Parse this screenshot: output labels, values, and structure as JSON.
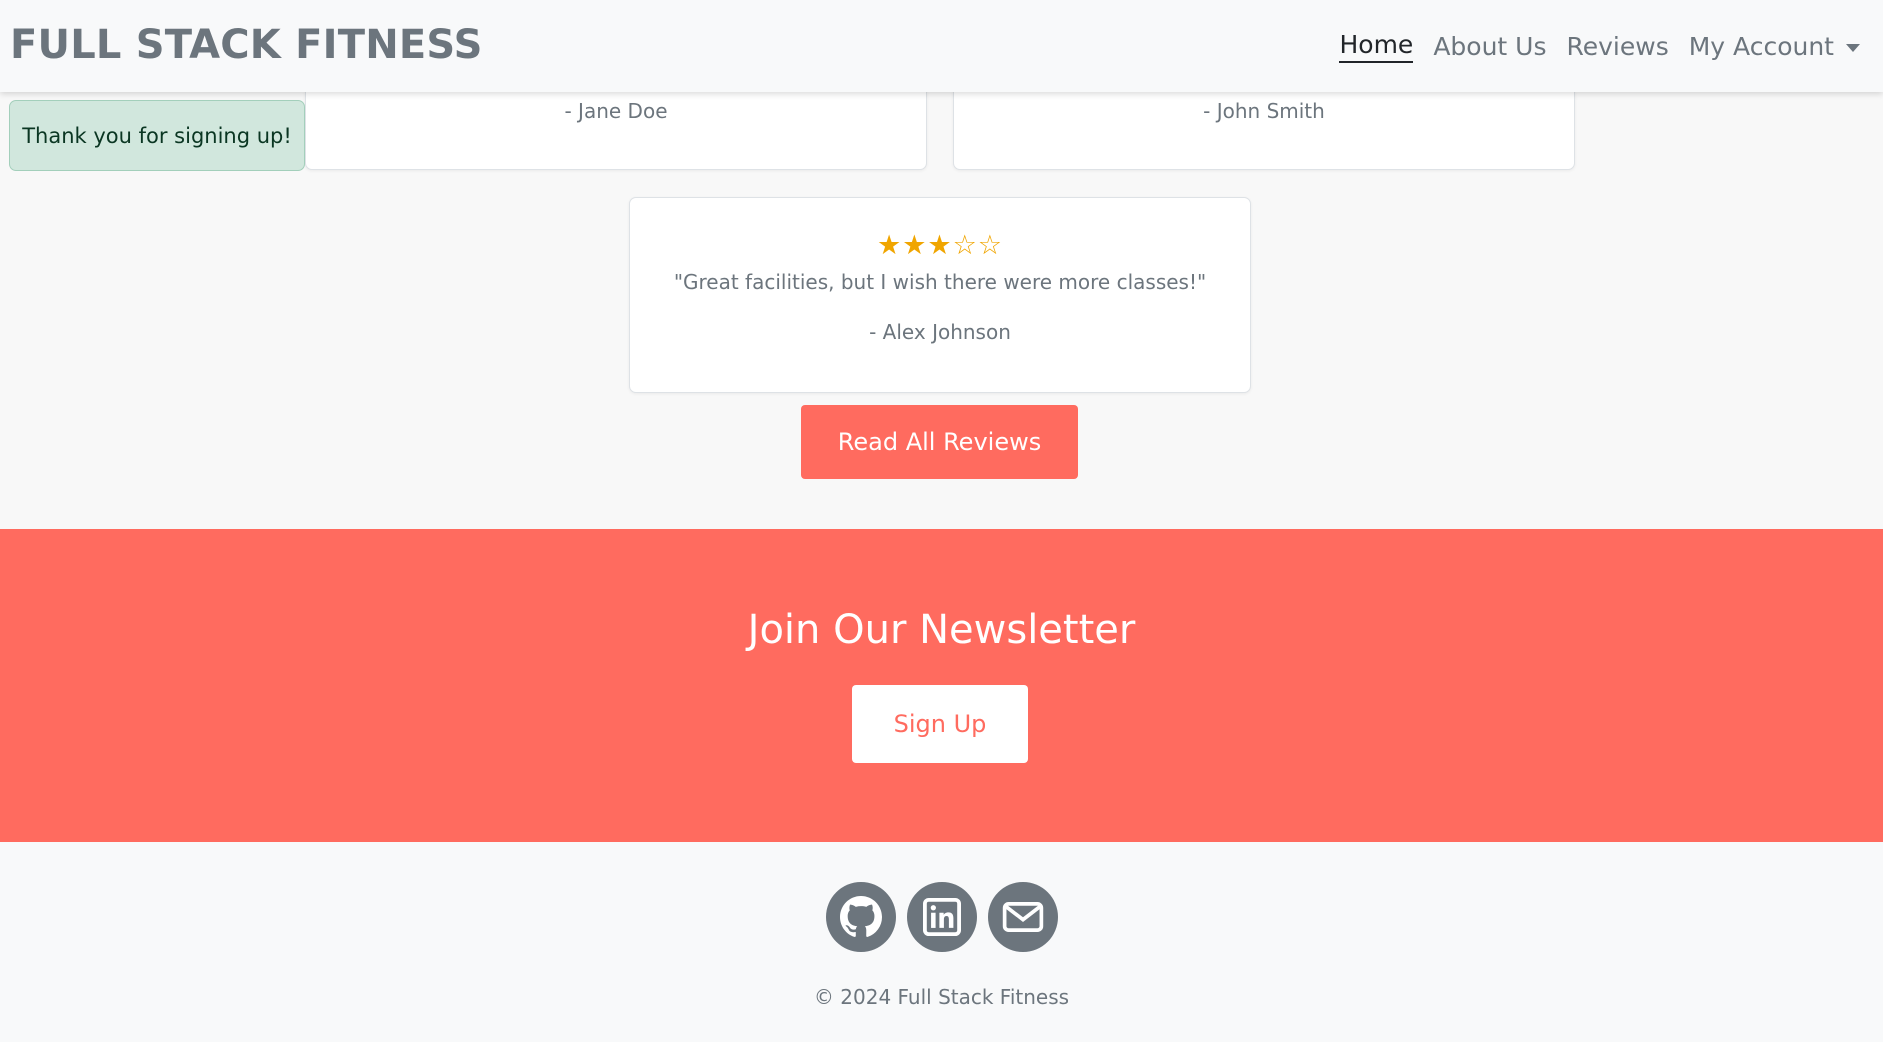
{
  "navbar": {
    "brand": "FULL STACK FITNESS",
    "links": [
      {
        "label": "Home",
        "active": true
      },
      {
        "label": "About Us"
      },
      {
        "label": "Reviews"
      },
      {
        "label": "My Account",
        "dropdown": true
      }
    ]
  },
  "alert": {
    "message": "Thank you for signing up!"
  },
  "reviews": [
    {
      "author": "- Jane Doe"
    },
    {
      "author": "- John Smith"
    },
    {
      "rating": 3,
      "max_rating": 5,
      "stars": "★★★☆☆",
      "quote": "\"Great facilities, but I wish there were more classes!\"",
      "author": "- Alex Johnson"
    }
  ],
  "reviews_button": {
    "label": "Read All Reviews"
  },
  "newsletter": {
    "title": "Join Our Newsletter",
    "button_label": "Sign Up"
  },
  "footer": {
    "social": [
      {
        "icon": "github-icon"
      },
      {
        "icon": "linkedin-icon"
      },
      {
        "icon": "envelope-icon"
      }
    ],
    "copyright": "© 2024 Full Stack Fitness"
  },
  "colors": {
    "accent": "#ff6b5f",
    "star": "#f0a500",
    "alert_bg": "#d1e7dd",
    "muted": "#6c757d"
  }
}
